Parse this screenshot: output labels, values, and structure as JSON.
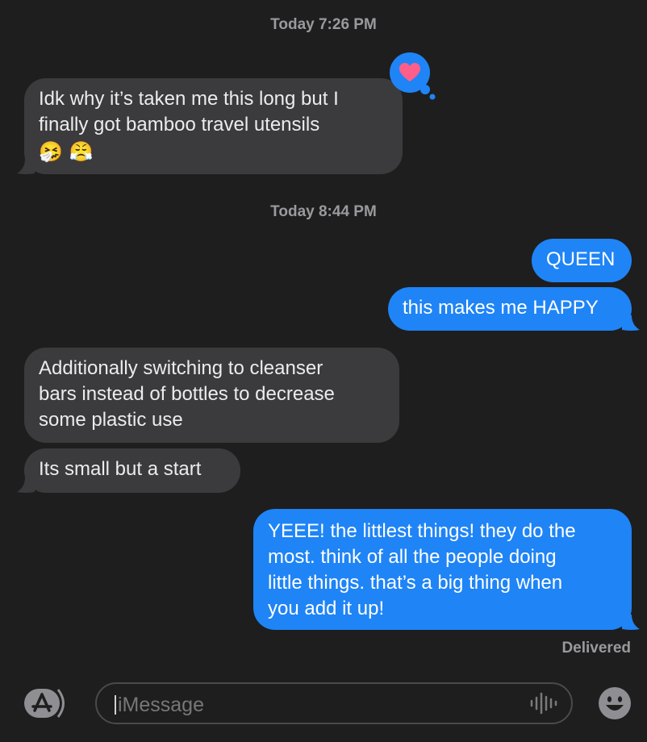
{
  "timestamps": [
    "Today 7:26 PM",
    "Today 8:44 PM"
  ],
  "messages": [
    {
      "from": "them",
      "lines": [
        "Idk why it’s taken me this long but I",
        "finally got bamboo travel utensils"
      ],
      "emoji": [
        "🤧",
        "😤"
      ],
      "reaction": "heart"
    },
    {
      "from": "me",
      "text": "QUEEN"
    },
    {
      "from": "me",
      "text": "this makes me HAPPY"
    },
    {
      "from": "them",
      "lines": [
        "Additionally switching to cleanser",
        "bars instead of bottles to decrease",
        "some plastic use"
      ]
    },
    {
      "from": "them",
      "text": "Its small but a start"
    },
    {
      "from": "me",
      "lines": [
        "YEEE! the littlest things! they do the",
        "most. think of all the people doing",
        "little things. that’s a big thing when",
        "you add it up!"
      ]
    }
  ],
  "status": "Delivered",
  "input": {
    "placeholder": "iMessage"
  },
  "colors": {
    "incoming": "#3b3b3d",
    "outgoing": "#1f84f6",
    "reaction_heart": "#ff5e8a",
    "background": "#1e1e1e"
  }
}
